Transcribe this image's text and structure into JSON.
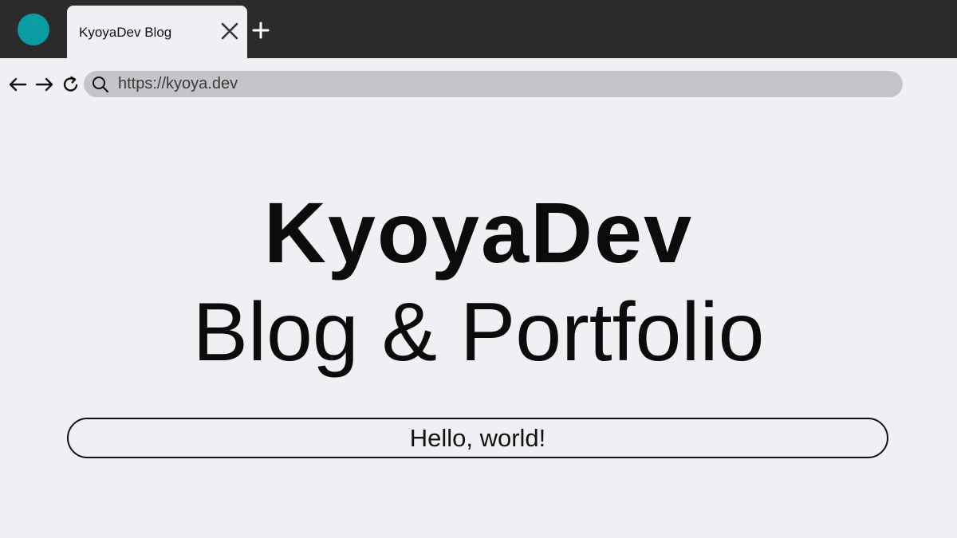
{
  "browser": {
    "tab": {
      "title": "KyoyaDev Blog"
    },
    "address_bar": {
      "url": "https://kyoya.dev"
    },
    "icons": {
      "favicon": "teal-circle",
      "close": "close-icon",
      "new_tab": "plus-icon",
      "back": "arrow-left-icon",
      "forward": "arrow-right-icon",
      "reload": "reload-icon",
      "search": "search-icon"
    },
    "colors": {
      "favicon": "#0a9ba3",
      "titlebar": "#2b2b2b",
      "page_bg": "#eff0f3",
      "address_bar_bg": "#c4c5c8"
    }
  },
  "page": {
    "title": "KyoyaDev",
    "subtitle": "Blog & Portfolio",
    "greeting": "Hello, world!"
  }
}
